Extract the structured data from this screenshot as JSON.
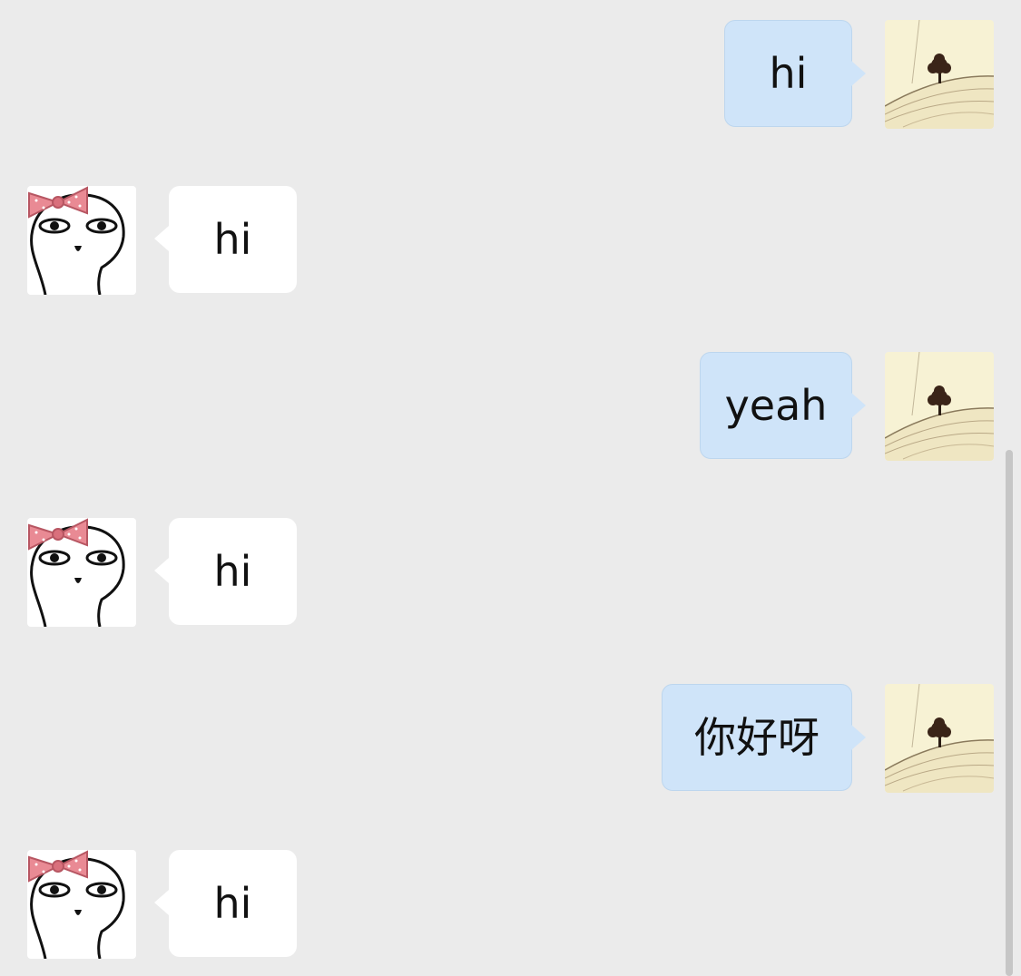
{
  "messages": [
    {
      "side": "sent",
      "text": "hi"
    },
    {
      "side": "received",
      "text": "hi"
    },
    {
      "side": "sent",
      "text": "yeah"
    },
    {
      "side": "received",
      "text": "hi"
    },
    {
      "side": "sent",
      "text": "你好呀"
    },
    {
      "side": "received",
      "text": "hi"
    }
  ],
  "icons": {
    "sent_avatar": "tree-on-hill-avatar",
    "received_avatar": "cartoon-girl-with-bow-avatar"
  },
  "colors": {
    "background": "#ebebeb",
    "sent_bubble": "#cfe4f9",
    "received_bubble": "#ffffff",
    "scrollbar": "#c6c6c6"
  }
}
